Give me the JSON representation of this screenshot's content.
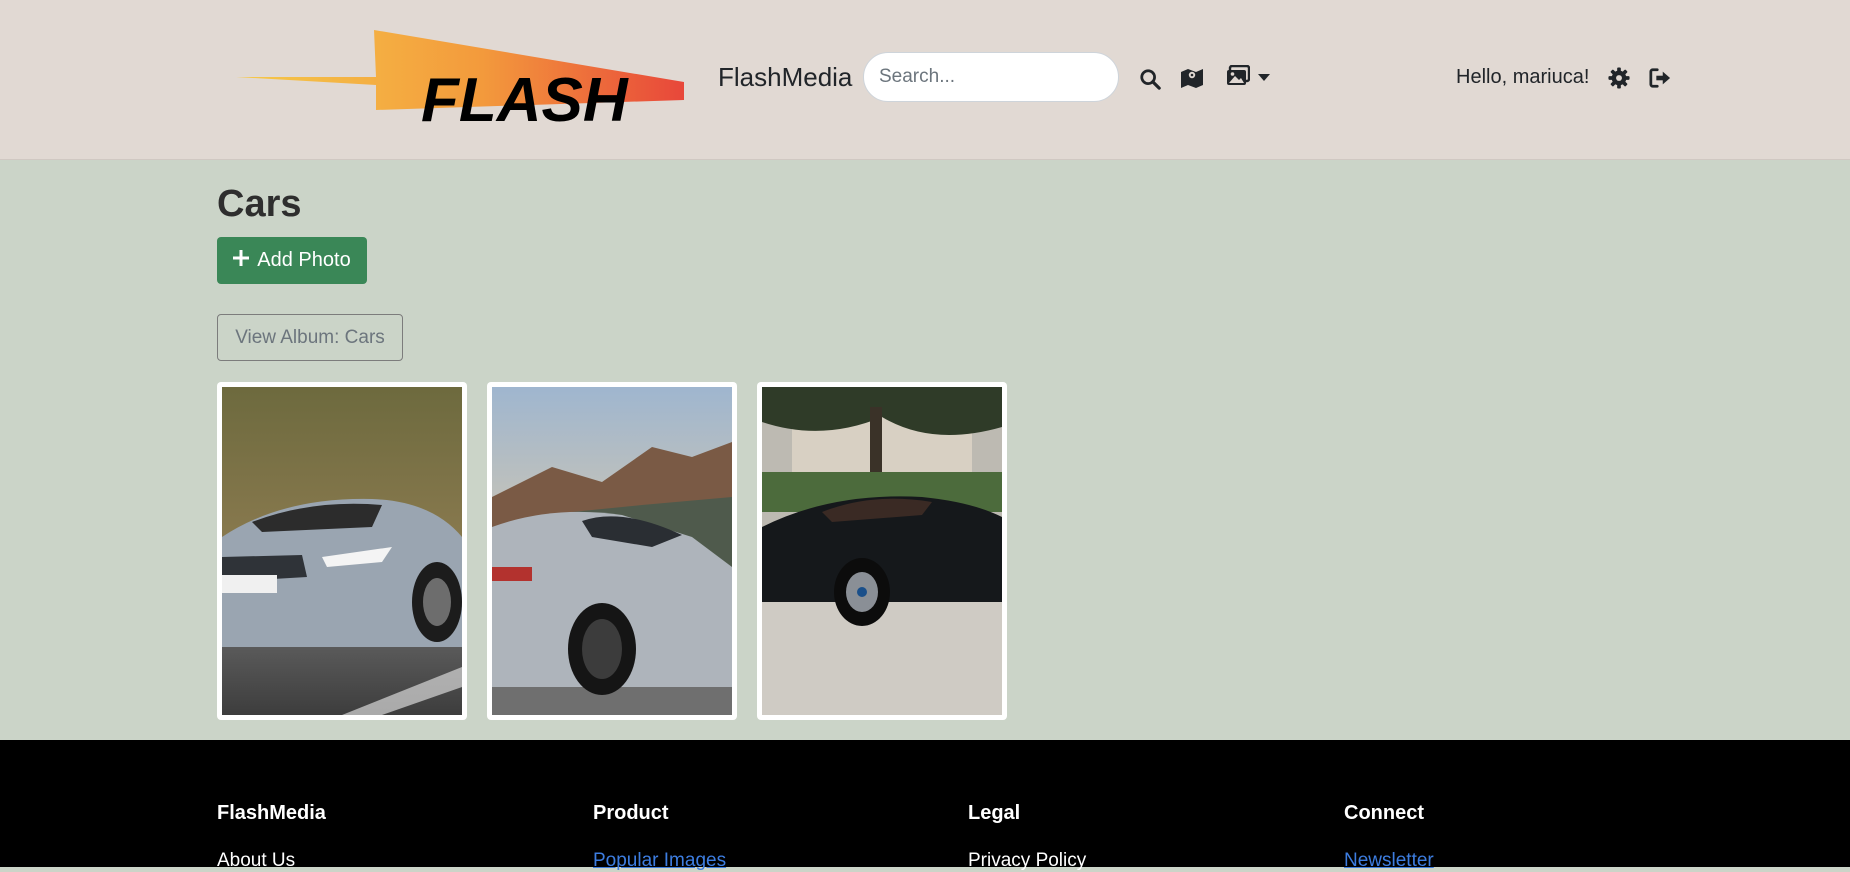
{
  "header": {
    "brand": "FlashMedia",
    "logo_text": "FLASH",
    "search_placeholder": "Search...",
    "greeting": "Hello, mariuca!",
    "icons": [
      "search-icon",
      "map-icon",
      "images-icon",
      "caret-down-icon",
      "gear-icon",
      "sign-out-icon"
    ]
  },
  "main": {
    "title": "Cars",
    "add_photo_label": "Add Photo",
    "view_album_label": "View Album: Cars",
    "photos": [
      {
        "subject": "silver convertible sports car"
      },
      {
        "subject": "silver SUV coupe by mountains"
      },
      {
        "subject": "black hypercar on gravel"
      }
    ]
  },
  "footer": {
    "columns": [
      {
        "heading": "FlashMedia",
        "link": "About Us"
      },
      {
        "heading": "Product",
        "link": "Popular Images"
      },
      {
        "heading": "Legal",
        "link": "Privacy Policy"
      },
      {
        "heading": "Connect",
        "link": "Newsletter"
      }
    ]
  },
  "colors": {
    "header_bg": "#e1d9d3",
    "content_bg": "#cbd4c8",
    "primary_green": "#3a8757",
    "footer_bg": "#000000",
    "link_blue": "#3d7de0"
  }
}
